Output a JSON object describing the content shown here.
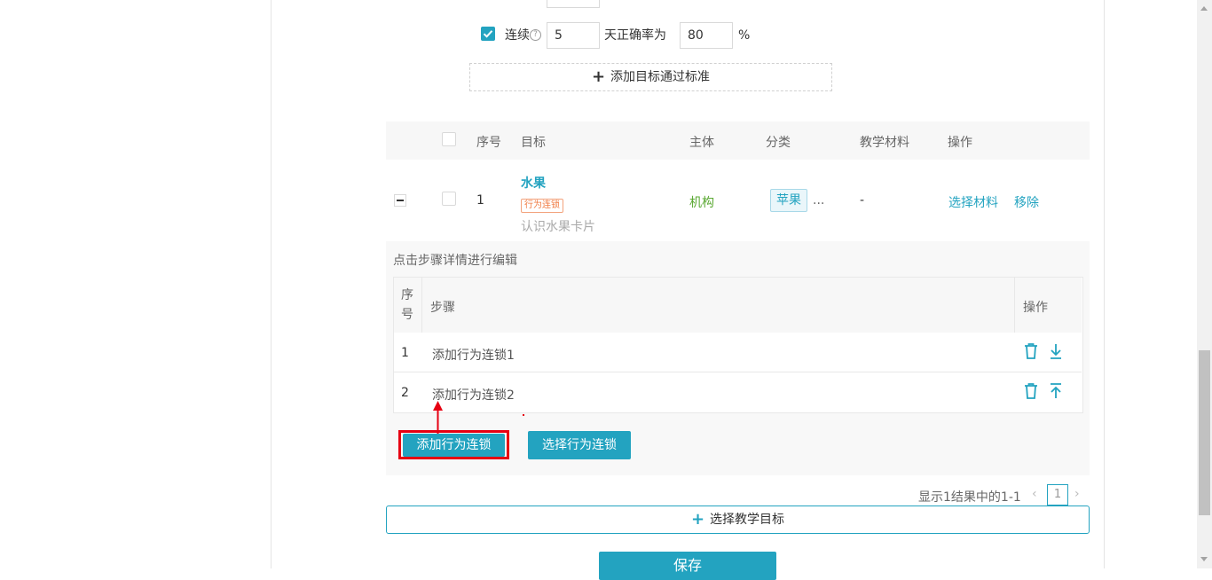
{
  "pass_standard": {
    "consecutive_label": "连续",
    "days_value": "5",
    "accuracy_label": "天正确率为",
    "accuracy_value": "80",
    "percent": "%",
    "add_standard_label": "添加目标通过标准"
  },
  "goals_table": {
    "headers": {
      "index": "序号",
      "goal": "目标",
      "subject": "主体",
      "category": "分类",
      "materials": "教学材料",
      "action": "操作"
    },
    "row": {
      "index": "1",
      "goal_name": "水果",
      "goal_tag": "行为连锁",
      "goal_desc": "认识水果卡片",
      "subject": "机构",
      "category": "苹果",
      "category_more": "...",
      "materials": "-",
      "select_material": "选择材料",
      "remove": "移除"
    }
  },
  "steps": {
    "hint": "点击步骤详情进行编辑",
    "headers": {
      "index": "序号",
      "step": "步骤",
      "action": "操作"
    },
    "rows": [
      {
        "index": "1",
        "step": "添加行为连锁1"
      },
      {
        "index": "2",
        "step": "添加行为连锁2"
      }
    ],
    "add_chain_label": "添加行为连锁",
    "select_chain_label": "选择行为连锁"
  },
  "pagination": {
    "summary": "显示1结果中的1-1",
    "current_page": "1"
  },
  "select_goal_label": "选择教学目标",
  "save_label": "保存",
  "colors": {
    "accent": "#23a3c0",
    "highlight": "#e60012",
    "tag": "#f07a41",
    "subject": "#5aa832"
  }
}
